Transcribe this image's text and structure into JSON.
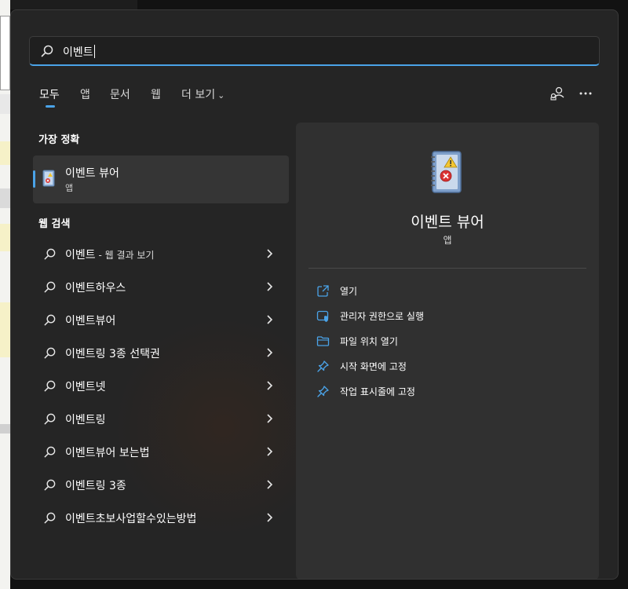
{
  "search": {
    "query": "이벤트"
  },
  "tabs": [
    {
      "label": "모두"
    },
    {
      "label": "앱"
    },
    {
      "label": "문서"
    },
    {
      "label": "웹"
    },
    {
      "label": "더 보기"
    }
  ],
  "best_match": {
    "section_title": "가장 정확",
    "title": "이벤트 뷰어",
    "subtitle": "앱"
  },
  "web_search": {
    "section_title": "웹 검색",
    "first_suffix": " - 웹 결과 보기",
    "items": [
      {
        "label": "이벤트"
      },
      {
        "label": "이벤트하우스"
      },
      {
        "label": "이벤트뷰어"
      },
      {
        "label": "이벤트링 3종 선택권"
      },
      {
        "label": "이벤트넷"
      },
      {
        "label": "이벤트링"
      },
      {
        "label": "이벤트뷰어 보는법"
      },
      {
        "label": "이벤트링 3종"
      },
      {
        "label": "이벤트초보사업할수있는방법"
      }
    ]
  },
  "detail": {
    "title": "이벤트 뷰어",
    "subtitle": "앱",
    "actions": [
      {
        "label": "열기",
        "icon": "open-external-icon"
      },
      {
        "label": "관리자 권한으로 실행",
        "icon": "admin-shield-icon"
      },
      {
        "label": "파일 위치 열기",
        "icon": "folder-icon"
      },
      {
        "label": "시작 화면에 고정",
        "icon": "pin-icon"
      },
      {
        "label": "작업 표시줄에 고정",
        "icon": "pin-icon"
      }
    ]
  },
  "colors": {
    "accent": "#4aa3e8",
    "panel_bg": "#252525",
    "detail_bg": "#303030",
    "selected_bg": "#353535"
  }
}
